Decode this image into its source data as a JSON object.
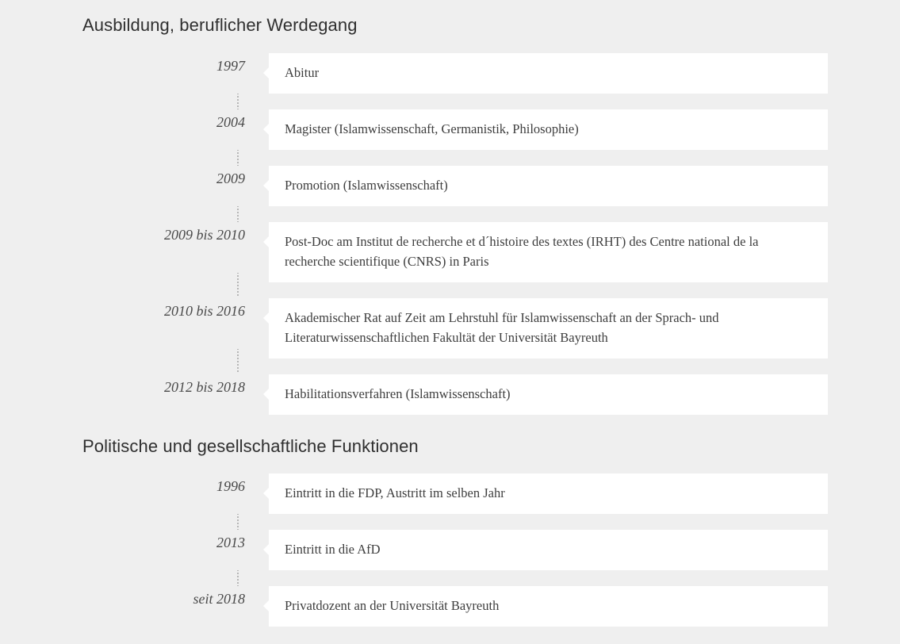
{
  "sections": [
    {
      "title": "Ausbildung, beruflicher Werdegang",
      "entries": [
        {
          "year": "1997",
          "text": "Abitur"
        },
        {
          "year": "2004",
          "text": "Magister (Islamwissenschaft, Germanistik, Philosophie)"
        },
        {
          "year": "2009",
          "text": "Promotion (Islamwissenschaft)"
        },
        {
          "year": "2009 bis 2010",
          "text": "Post-Doc am Institut de recherche et d´histoire des textes (IRHT) des Centre national de la recherche scientifique (CNRS) in Paris"
        },
        {
          "year": "2010 bis 2016",
          "text": "Akademischer Rat auf Zeit am Lehrstuhl für Islamwissenschaft an der Sprach- und Literaturwissenschaftlichen Fakultät der Universität Bayreuth"
        },
        {
          "year": "2012 bis 2018",
          "text": "Habilitationsverfahren (Islamwissenschaft)"
        }
      ]
    },
    {
      "title": "Politische und gesellschaftliche Funktionen",
      "entries": [
        {
          "year": "1996",
          "text": "Eintritt in die FDP, Austritt im selben Jahr"
        },
        {
          "year": "2013",
          "text": "Eintritt in die AfD"
        },
        {
          "year": "seit 2018",
          "text": "Privatdozent an der Universität Bayreuth"
        }
      ]
    }
  ]
}
